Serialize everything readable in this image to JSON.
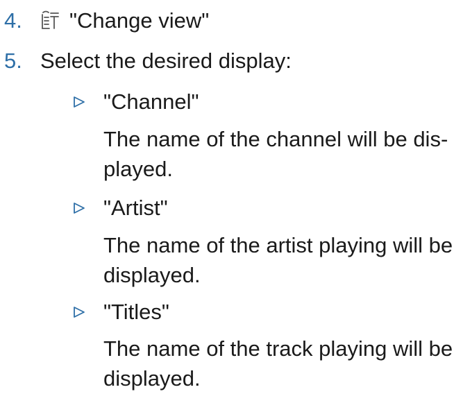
{
  "steps": [
    {
      "number": "4.",
      "icon": "change-view-icon",
      "text": "\"Change view\""
    },
    {
      "number": "5.",
      "text": "Select the desired display:"
    }
  ],
  "options": [
    {
      "label": "\"Channel\"",
      "description_lines": [
        "The name of the channel will be dis-",
        "played."
      ]
    },
    {
      "label": "\"Artist\"",
      "description_lines": [
        "The name of the artist playing will be",
        "displayed."
      ]
    },
    {
      "label": "\"Titles\"",
      "description_lines": [
        "The name of the track playing will be",
        "displayed."
      ]
    }
  ],
  "colors": {
    "accent": "#2e6fa7",
    "text": "#1a1a1a"
  }
}
